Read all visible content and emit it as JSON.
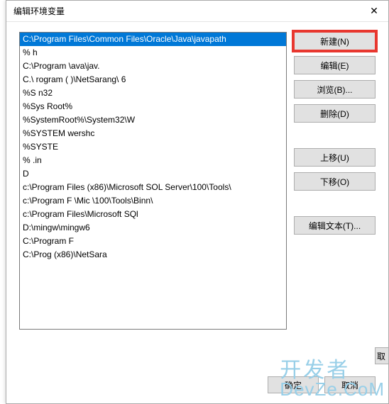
{
  "dialog": {
    "title": "编辑环境变量",
    "close_symbol": "✕"
  },
  "list_items": [
    {
      "text": "C:\\Program Files\\Common Files\\Oracle\\Java\\javapath",
      "selected": true
    },
    {
      "text": "%                                                         h"
    },
    {
      "text": "C:\\Program                                         \\ava\\jav. "
    },
    {
      "text": "C.\\ rogram        (   )\\NetSarang\\             6"
    },
    {
      "text": "%S                              n32"
    },
    {
      "text": "%Sys      Root%"
    },
    {
      "text": "%SystemRoot%\\System32\\W"
    },
    {
      "text": "%SYSTEM                                               wershc"
    },
    {
      "text": "%SYSTE"
    },
    {
      "text": "%                              .in"
    },
    {
      "text": "D"
    },
    {
      "text": "c:\\Program Files (x86)\\Microsoft SOL Server\\100\\Tools\\"
    },
    {
      "text": "c:\\Program F    \\Mic                        \\100\\Tools\\Binn\\"
    },
    {
      "text": "c:\\Program Files\\Microsoft SQl"
    },
    {
      "text": "D:\\mingw\\mingw6"
    },
    {
      "text": "C:\\Program F"
    },
    {
      "text": "C:\\Prog                   (x86)\\NetSara"
    }
  ],
  "buttons": {
    "new": "新建(N)",
    "edit": "编辑(E)",
    "browse": "浏览(B)...",
    "delete": "删除(D)",
    "move_up": "上移(U)",
    "move_down": "下移(O)",
    "edit_text": "编辑文本(T)..."
  },
  "footer": {
    "ok": "确定",
    "cancel": "取消",
    "edge_cancel": "取"
  },
  "watermark": {
    "line1": "开发者",
    "line2": "DevZe.CoM"
  }
}
